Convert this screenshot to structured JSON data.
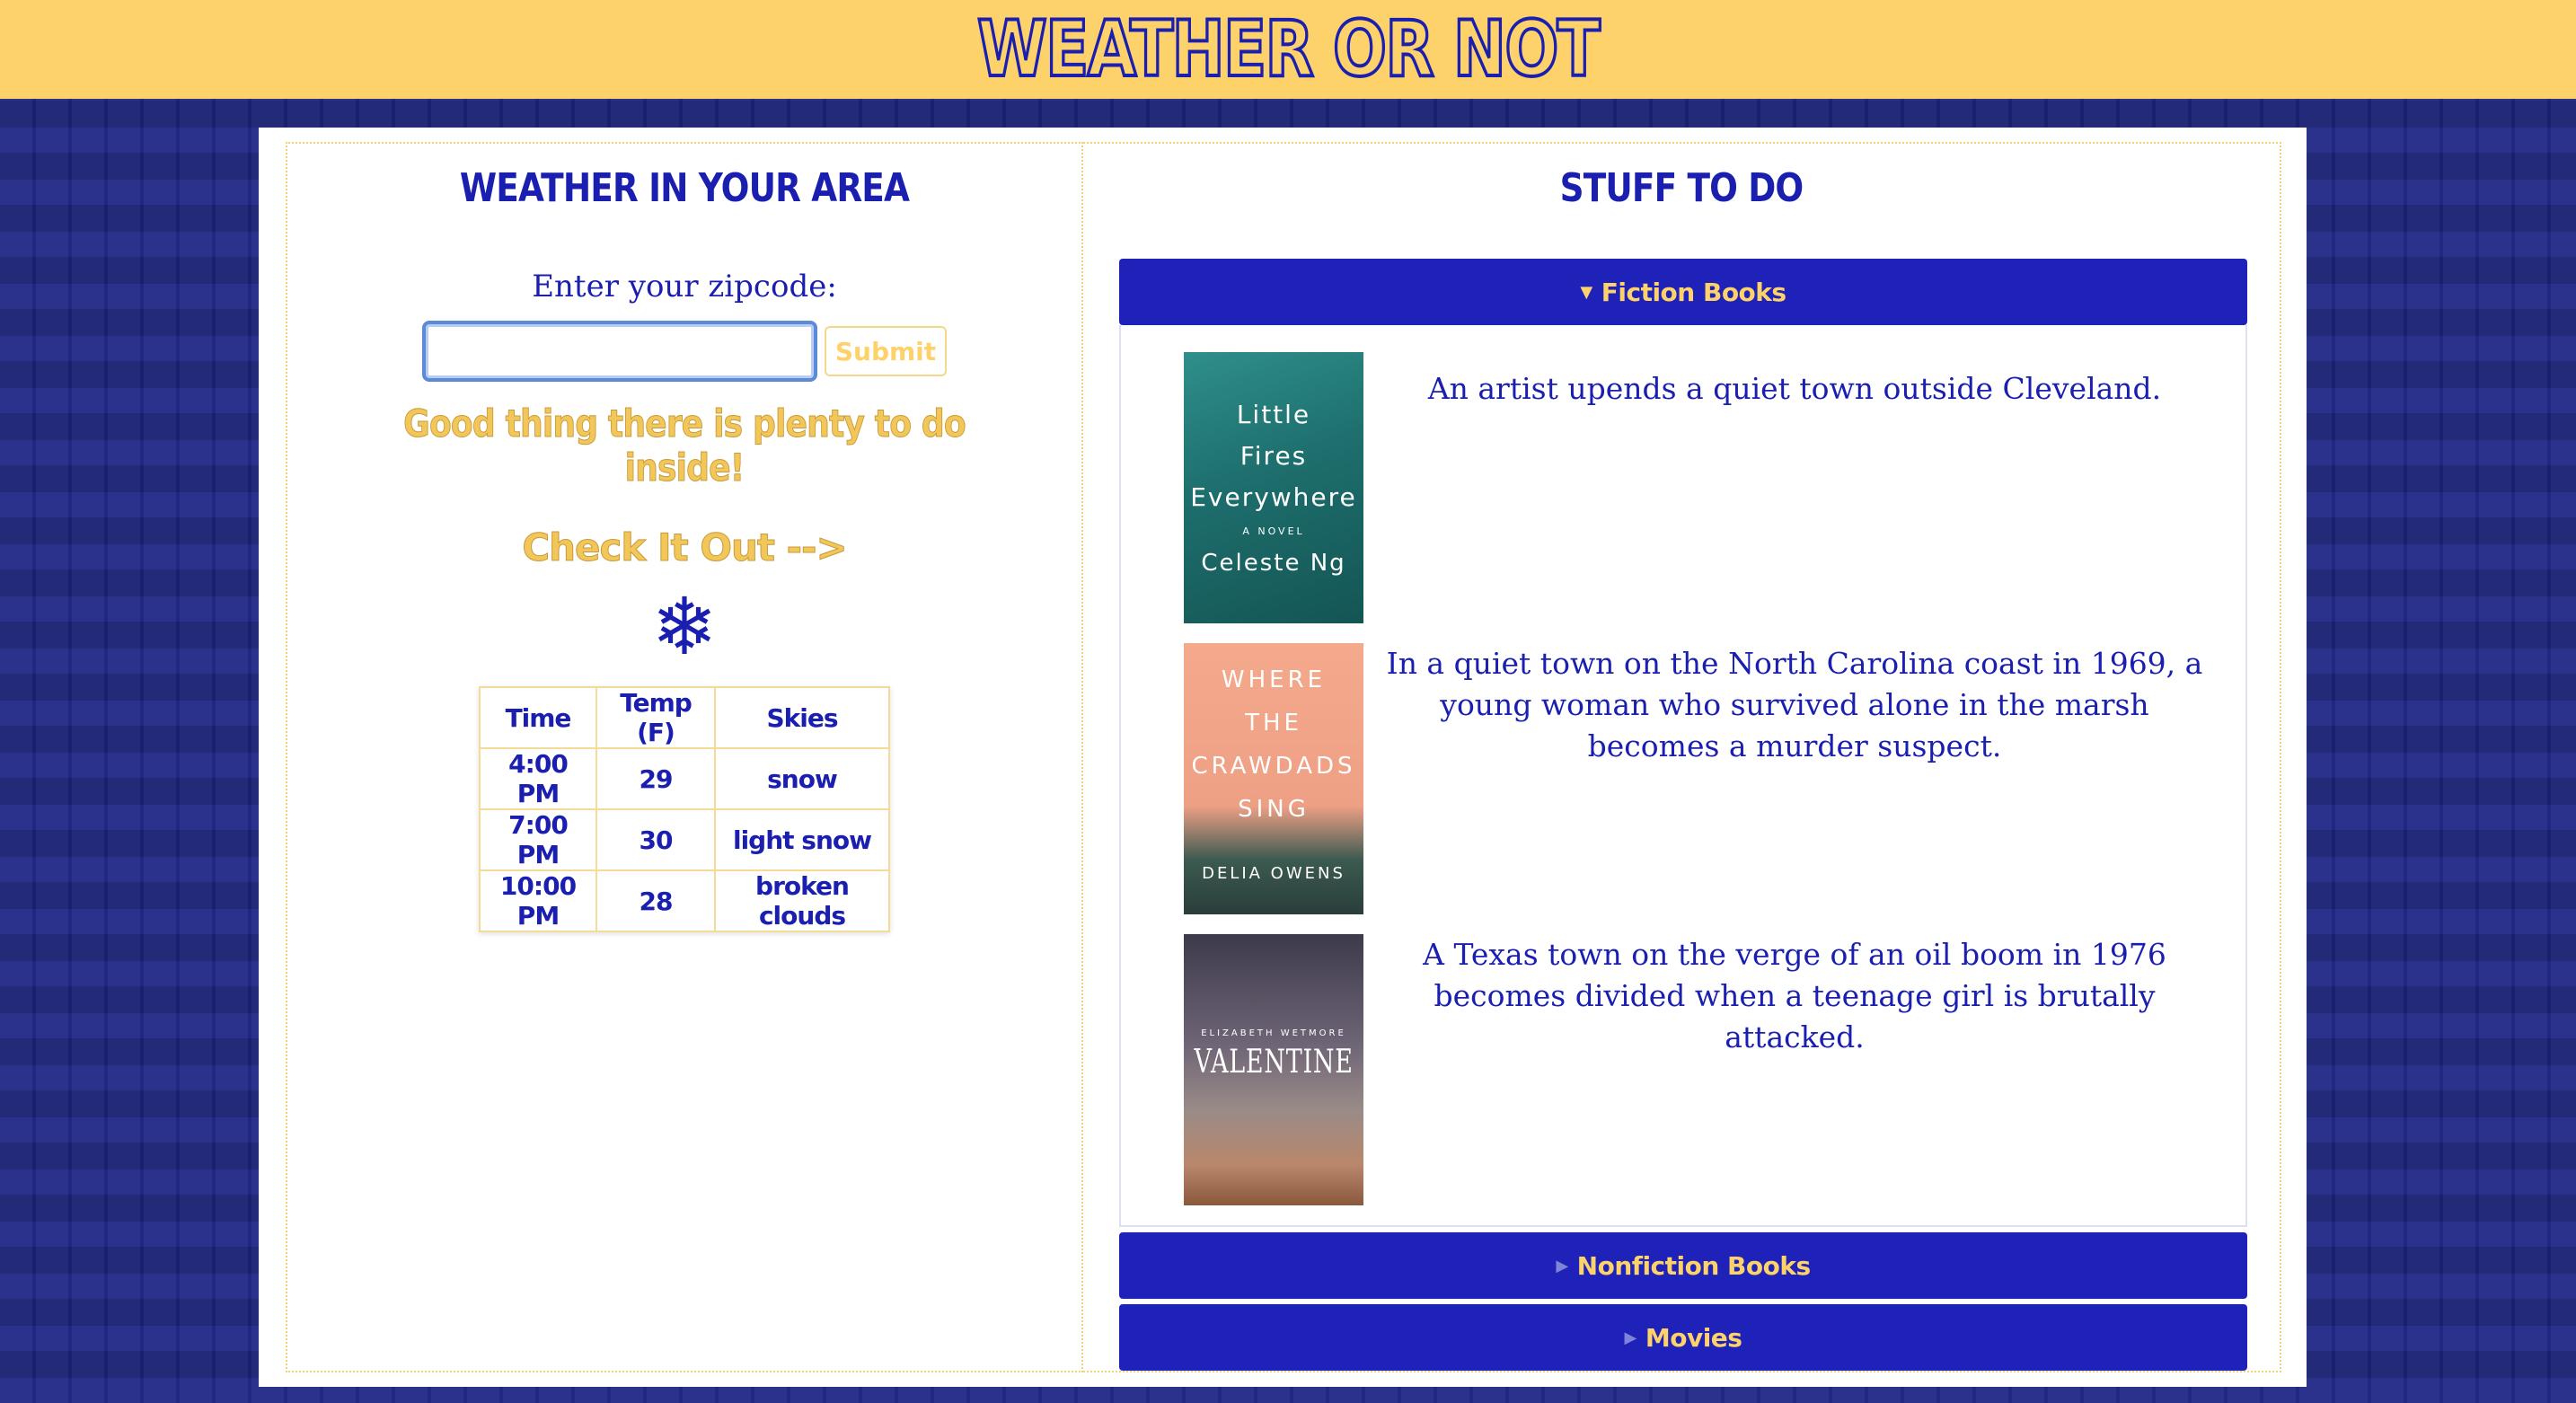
{
  "header": {
    "title": "WEATHER OR NOT"
  },
  "weather": {
    "heading": "WEATHER IN YOUR AREA",
    "zip_label": "Enter your zipcode:",
    "zip_value": "",
    "submit_label": "Submit",
    "message": "Good thing there is plenty to do inside!",
    "check_link": "Check It Out -->",
    "condition_icon": "snowflake-icon",
    "table": {
      "headers": [
        "Time",
        "Temp (F)",
        "Skies"
      ],
      "rows": [
        [
          "4:00 PM",
          "29",
          "snow"
        ],
        [
          "7:00 PM",
          "30",
          "light snow"
        ],
        [
          "10:00 PM",
          "28",
          "broken clouds"
        ]
      ]
    }
  },
  "stuff": {
    "heading": "STUFF TO DO",
    "sections": [
      {
        "label": "Fiction Books",
        "expanded": true
      },
      {
        "label": "Nonfiction Books",
        "expanded": false
      },
      {
        "label": "Movies",
        "expanded": false
      }
    ],
    "fiction_books": [
      {
        "cover_lines": [
          "Little",
          "Fires",
          "Everywhere"
        ],
        "cover_sub": "A NOVEL",
        "cover_author": "Celeste Ng",
        "description": "An artist upends a quiet town outside Cleveland."
      },
      {
        "cover_lines": [
          "WHERE",
          "THE",
          "CRAWDADS",
          "SING"
        ],
        "cover_author": "DELIA OWENS",
        "description": "In a quiet town on the North Carolina coast in 1969, a young woman who survived alone in the marsh becomes a murder suspect."
      },
      {
        "cover_author": "ELIZABETH WETMORE",
        "cover_lines": [
          "VALENTINE"
        ],
        "description": "A Texas town on the verge of an oil boom in 1976 becomes divided when a teenage girl is brutally attacked."
      }
    ]
  },
  "colors": {
    "accent_yellow": "#fed26a",
    "brand_blue": "#1a1fb0",
    "accordion_blue": "#1e22b8"
  }
}
